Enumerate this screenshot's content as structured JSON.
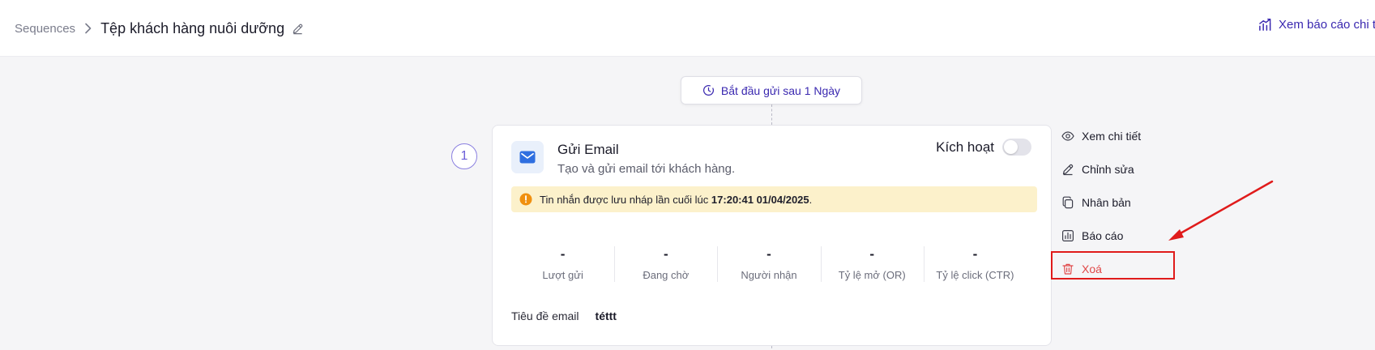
{
  "header": {
    "breadcrumb_root": "Sequences",
    "sequence_title": "Tệp khách hàng nuôi dưỡng",
    "report_link": "Xem báo cáo chi tiết"
  },
  "flow": {
    "start_delay_label": "Bắt đầu gửi sau 1 Ngày",
    "step_number": "1"
  },
  "step": {
    "title": "Gửi Email",
    "description": "Tạo và gửi email tới khách hàng.",
    "activate_label": "Kích hoạt",
    "activated": false,
    "draft_notice": "Tin nhắn được lưu nháp lần cuối lúc ",
    "draft_time": "17:20:41 01/04/2025",
    "draft_period": ".",
    "stats": [
      {
        "value": "-",
        "label": "Lượt gửi"
      },
      {
        "value": "-",
        "label": "Đang chờ"
      },
      {
        "value": "-",
        "label": "Người nhận"
      },
      {
        "value": "-",
        "label": "Tỷ lệ mở (OR)"
      },
      {
        "value": "-",
        "label": "Tỷ lệ click (CTR)"
      }
    ],
    "subject_label": "Tiêu đề email",
    "subject_value": "téttt"
  },
  "actions": [
    {
      "label": "Xem chi tiết",
      "icon": "eye-icon"
    },
    {
      "label": "Chỉnh sửa",
      "icon": "pencil-icon"
    },
    {
      "label": "Nhân bản",
      "icon": "copy-icon"
    },
    {
      "label": "Báo cáo",
      "icon": "report-icon"
    },
    {
      "label": "Xoá",
      "icon": "trash-icon"
    }
  ],
  "colors": {
    "accent": "#3a28b0",
    "danger": "#e04848",
    "alert_bg": "#fcf1cb",
    "highlight": "#e01b1b"
  }
}
